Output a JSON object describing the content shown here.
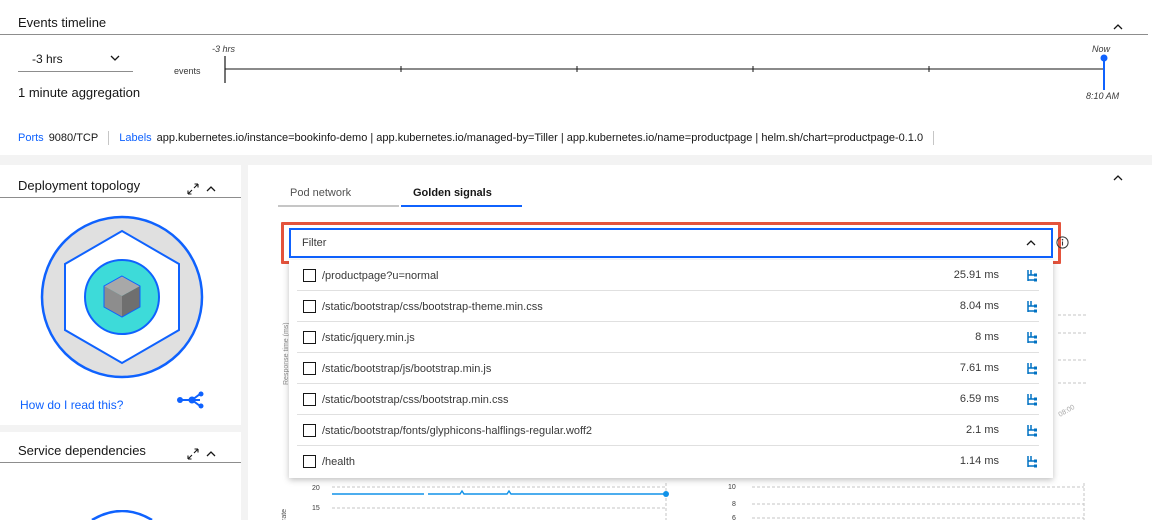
{
  "events": {
    "title": "Events timeline",
    "range_value": "-3 hrs",
    "aggregation": "1 minute aggregation",
    "timeline": {
      "start_label": "-3 hrs",
      "end_label": "Now",
      "row_label": "events",
      "time_label": "8:10 AM"
    }
  },
  "info": {
    "ports_label": "Ports",
    "ports_value": "9080/TCP",
    "labels_label": "Labels",
    "labels_value": "app.kubernetes.io/instance=bookinfo-demo | app.kubernetes.io/managed-by=Tiller | app.kubernetes.io/name=productpage | helm.sh/chart=productpage-0.1.0"
  },
  "topology": {
    "title": "Deployment topology",
    "howto": "How do I read this?"
  },
  "dependencies": {
    "title": "Service dependencies"
  },
  "tabs": [
    {
      "label": "Pod network",
      "active": false
    },
    {
      "label": "Golden signals",
      "active": true
    }
  ],
  "filter": {
    "placeholder": "Filter"
  },
  "endpoints": [
    {
      "path": "/productpage?u=normal",
      "value": "25.91 ms"
    },
    {
      "path": "/static/bootstrap/css/bootstrap-theme.min.css",
      "value": "8.04 ms"
    },
    {
      "path": "/static/jquery.min.js",
      "value": "8 ms"
    },
    {
      "path": "/static/bootstrap/js/bootstrap.min.js",
      "value": "7.61 ms"
    },
    {
      "path": "/static/bootstrap/css/bootstrap.min.css",
      "value": "6.59 ms"
    },
    {
      "path": "/static/bootstrap/fonts/glyphicons-halflings-regular.woff2",
      "value": "2.1 ms"
    },
    {
      "path": "/health",
      "value": "1.14 ms"
    }
  ],
  "background_charts": {
    "left_ticks": [
      "20",
      "15"
    ],
    "right_ticks": [
      "10",
      "8",
      "6"
    ],
    "peek_time": "08:00"
  },
  "colors": {
    "accent": "#0f62fe",
    "highlight": "#e4533c",
    "trace_icon": "#0072c3"
  }
}
